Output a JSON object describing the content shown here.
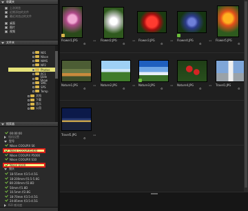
{
  "sidebar": {
    "favorites_header": "收藏夹",
    "favorites": [
      {
        "label": "上次浏览",
        "bright": false
      },
      {
        "label": "近期添加的文件",
        "bright": false
      },
      {
        "label": "最近浏览过的文件",
        "bright": false
      },
      {
        "label": "桌面",
        "bright": true
      },
      {
        "label": "图片",
        "bright": true
      },
      {
        "label": "视频",
        "bright": true
      }
    ],
    "folders_header": "文件夹",
    "tree": [
      {
        "label": "N01",
        "selected": false
      },
      {
        "label": "Nikon",
        "selected": false
      },
      {
        "label": "NIMS",
        "selected": false
      },
      {
        "label": "NP2",
        "selected": false
      },
      {
        "label": "Photos",
        "selected": true
      },
      {
        "label": "PC1",
        "selected": false
      },
      {
        "label": "Slide Show",
        "selected": false
      },
      {
        "label": "SMC",
        "selected": false
      },
      {
        "label": "SPS",
        "selected": false
      },
      {
        "label": "Temp",
        "selected": false
      },
      {
        "label": "文档",
        "selected": false
      },
      {
        "label": "下载",
        "selected": false
      },
      {
        "label": "音乐",
        "selected": false
      },
      {
        "label": "公用",
        "selected": false
      }
    ],
    "filter_header": "搜索器",
    "filters": [
      {
        "label": "00:00:00",
        "kind": "check"
      },
      {
        "label": "相机设置",
        "kind": "tri"
      },
      {
        "label": "型号",
        "kind": "tri-down"
      },
      {
        "label": "Nikon COOLPIX S6",
        "kind": "check"
      },
      {
        "label": "Nikon COOLPIX5400",
        "kind": "highlight"
      },
      {
        "label": "Nikon COOLPIX P5000",
        "kind": "check"
      },
      {
        "label": "Nikon COOLPIX S10",
        "kind": "check"
      },
      {
        "label": "Nikon D100",
        "kind": "highlight"
      },
      {
        "label": "镜头",
        "kind": "tri-down"
      },
      {
        "label": "18-55mm f/3.5-4.5G",
        "kind": "check"
      },
      {
        "label": "18-200mm f/3.5-5.6G",
        "kind": "check"
      },
      {
        "label": "80-200mm f/2.8D",
        "kind": "check"
      },
      {
        "label": "50mm f/1.8D",
        "kind": "check"
      },
      {
        "label": "10.5mm f/2.8G",
        "kind": "check"
      },
      {
        "label": "18-70mm f/3.5-4.5G",
        "kind": "check"
      },
      {
        "label": "24-85mm f/3.5-4.5G",
        "kind": "check"
      },
      {
        "label": "ISO 感光度",
        "kind": "tri"
      },
      {
        "label": "焦距",
        "kind": "tri"
      }
    ]
  },
  "thumbnails": [
    {
      "name": "Flower1.JPG",
      "count": "x1",
      "badge_color": "#d9b54a"
    },
    {
      "name": "Flower2.JPG",
      "count": "x1",
      "badge_color": ""
    },
    {
      "name": "Flower3.JPG",
      "count": "x1",
      "badge_color": ""
    },
    {
      "name": "Flower4.JPG",
      "count": "x1",
      "badge_color": "#6bbf3a"
    },
    {
      "name": "Flower5.JPG",
      "count": "x1",
      "badge_color": ""
    },
    {
      "name": "Nature1.JPG",
      "count": "x1",
      "badge_color": ""
    },
    {
      "name": "Nature2.JPG",
      "count": "x1",
      "badge_color": ""
    },
    {
      "name": "Nature3.JPG",
      "count": "x1",
      "badge_color": "#6bbf3a"
    },
    {
      "name": "Nature4.JPG",
      "count": "x1",
      "badge_color": ""
    },
    {
      "name": "Travel1.JPG",
      "count": "x1",
      "badge_color": ""
    },
    {
      "name": "Travel5.JPG",
      "count": "x1",
      "badge_color": ""
    }
  ],
  "colors": {
    "highlight_border": "#e0201a",
    "highlight_fill": "#fff78a",
    "selected_folder": "#e5e27a"
  }
}
